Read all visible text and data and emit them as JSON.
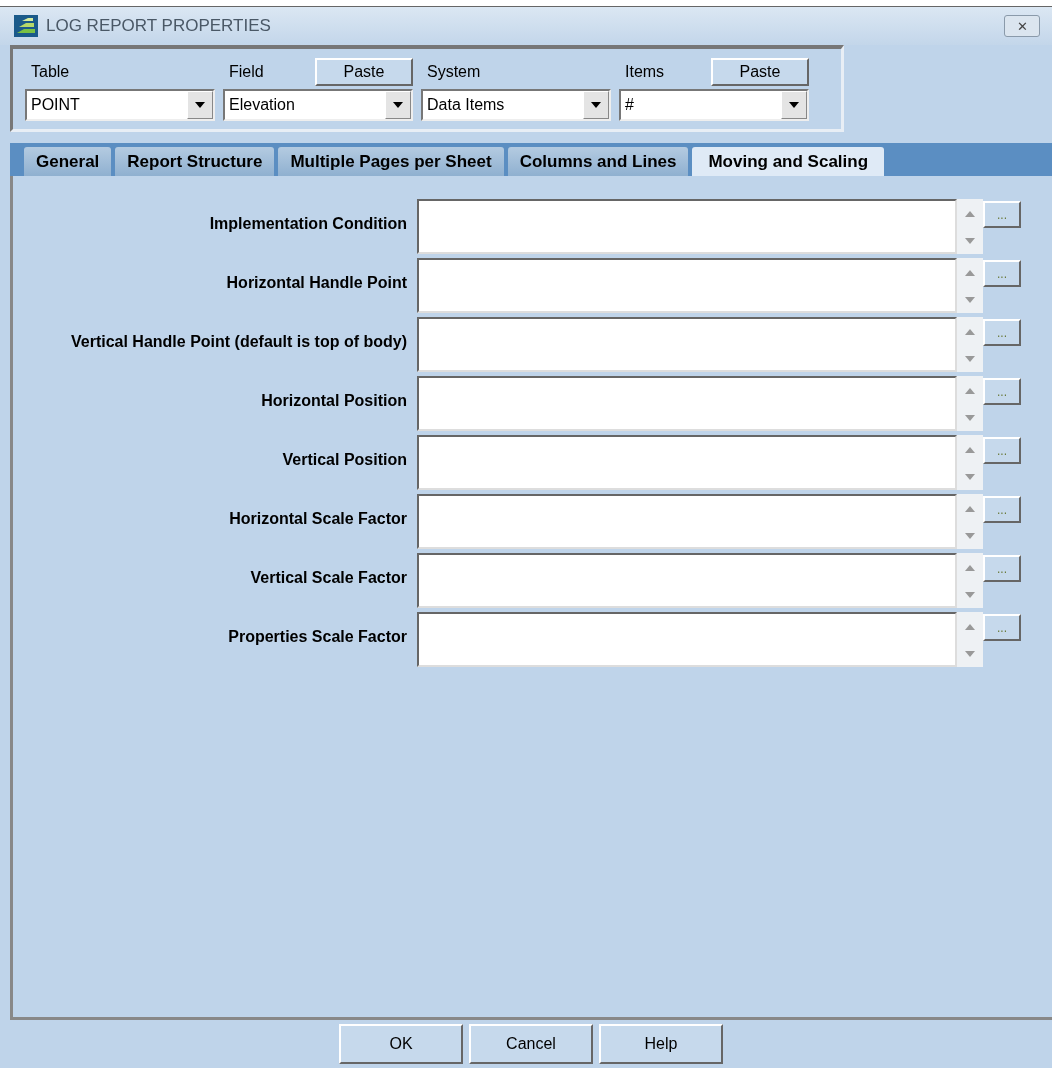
{
  "window": {
    "title": "LOG REPORT PROPERTIES",
    "close": "✕"
  },
  "selectors": [
    {
      "label": "Table",
      "value": "POINT"
    },
    {
      "label": "Field",
      "value": "Elevation",
      "paste": "Paste"
    },
    {
      "label": "System",
      "value": "Data Items"
    },
    {
      "label": "Items",
      "value": "#",
      "paste": "Paste"
    }
  ],
  "tabs": [
    {
      "label": "General",
      "selected": false
    },
    {
      "label": "Report Structure",
      "selected": false
    },
    {
      "label": "Multiple Pages per Sheet",
      "selected": false
    },
    {
      "label": "Columns and Lines",
      "selected": false
    },
    {
      "label": "Moving and Scaling",
      "selected": true
    }
  ],
  "fields": [
    {
      "label": "Implementation Condition",
      "button": "..."
    },
    {
      "label": "Horizontal Handle Point",
      "button": "..."
    },
    {
      "label": "Vertical Handle Point (default is top of body)",
      "button": "..."
    },
    {
      "label": "Horizontal Position",
      "button": "..."
    },
    {
      "label": "Vertical Position",
      "button": "..."
    },
    {
      "label": "Horizontal Scale Factor",
      "button": "..."
    },
    {
      "label": "Vertical Scale Factor",
      "button": "..."
    },
    {
      "label": "Properties Scale Factor",
      "button": "..."
    }
  ],
  "buttons": [
    "OK",
    "Cancel",
    "Help"
  ]
}
